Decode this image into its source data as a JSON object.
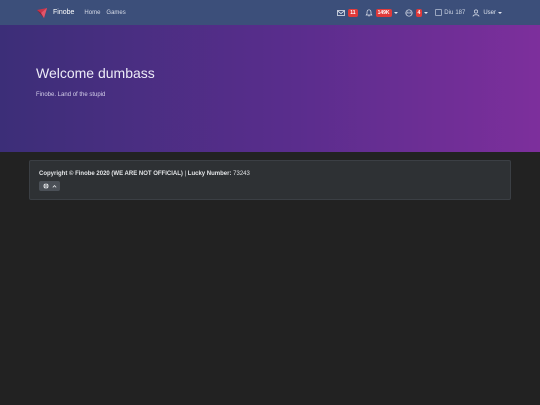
{
  "navbar": {
    "brand": "Finobe",
    "links": [
      "Home",
      "Games"
    ],
    "messages_count": "11",
    "notifications_count": "149K",
    "friends_count": "4",
    "coin_alt": "Diu",
    "coin_amount": "187",
    "user_label": "User"
  },
  "hero": {
    "title": "Welcome dumbass",
    "subtitle": "Finobe. Land of the stupid"
  },
  "footer": {
    "copyright": "Copyright © Finobe 2020 (WE ARE NOT OFFICIAL)",
    "separator": " | ",
    "lucky_label": "Lucky Number:",
    "lucky_value": "73243"
  },
  "colors": {
    "navbar_bg": "#3c4f7a",
    "badge": "#e03a3a",
    "hero_start": "#3c2e78",
    "hero_end": "#7d2f9c",
    "page_bg": "#222222"
  },
  "icons": [
    "brand-logo-icon",
    "envelope-icon",
    "bell-icon",
    "friends-icon",
    "user-icon",
    "globe-icon",
    "chevron-up-icon"
  ]
}
